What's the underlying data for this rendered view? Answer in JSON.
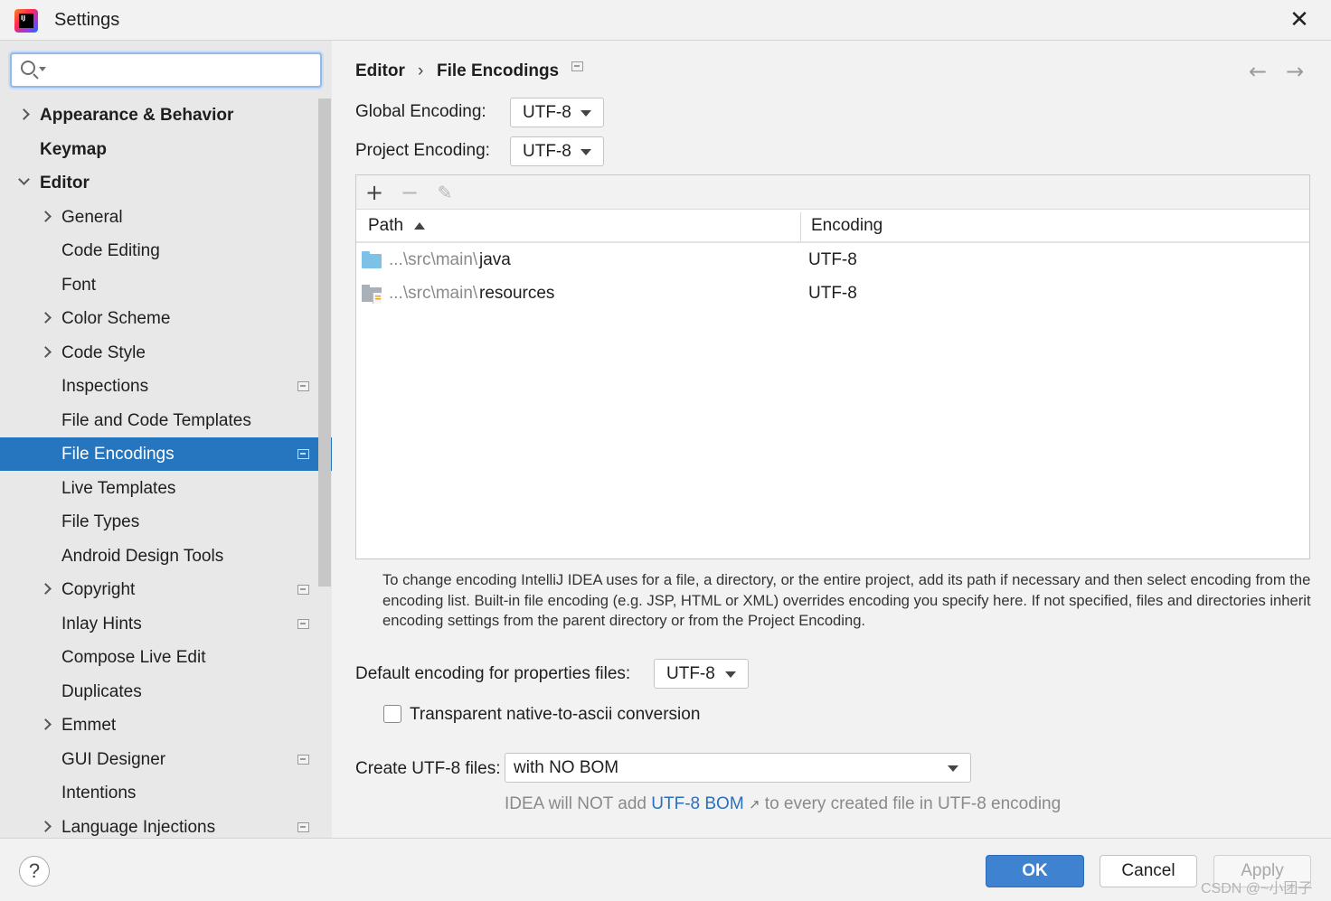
{
  "window": {
    "title": "Settings",
    "close_glyph": "✕",
    "logo_text": "IJ"
  },
  "search": {
    "placeholder": "",
    "value": ""
  },
  "sidebar": {
    "items": [
      {
        "label": "Appearance & Behavior",
        "expander": "collapsed",
        "bold": true
      },
      {
        "label": "Keymap",
        "bold": true
      },
      {
        "label": "Editor",
        "expander": "expanded",
        "bold": true
      },
      {
        "label": "General",
        "expander": "collapsed"
      },
      {
        "label": "Code Editing"
      },
      {
        "label": "Font"
      },
      {
        "label": "Color Scheme",
        "expander": "collapsed"
      },
      {
        "label": "Code Style",
        "expander": "collapsed"
      },
      {
        "label": "Inspections",
        "project_icon": true
      },
      {
        "label": "File and Code Templates"
      },
      {
        "label": "File Encodings",
        "project_icon": true,
        "selected": true
      },
      {
        "label": "Live Templates"
      },
      {
        "label": "File Types"
      },
      {
        "label": "Android Design Tools"
      },
      {
        "label": "Copyright",
        "expander": "collapsed",
        "project_icon": true
      },
      {
        "label": "Inlay Hints",
        "project_icon": true
      },
      {
        "label": "Compose Live Edit"
      },
      {
        "label": "Duplicates"
      },
      {
        "label": "Emmet",
        "expander": "collapsed"
      },
      {
        "label": "GUI Designer",
        "project_icon": true
      },
      {
        "label": "Intentions"
      },
      {
        "label": "Language Injections",
        "expander": "collapsed",
        "project_icon": true
      }
    ]
  },
  "breadcrumb": {
    "parent": "Editor",
    "separator": "›",
    "current": "File Encodings"
  },
  "nav": {
    "back_glyph": "←",
    "forward_glyph": "→"
  },
  "global_encoding": {
    "label": "Global Encoding:",
    "value": "UTF-8"
  },
  "project_encoding": {
    "label": "Project Encoding:",
    "value": "UTF-8"
  },
  "toolbar": {
    "add_glyph": "+",
    "remove_glyph": "−",
    "edit_glyph": "✎"
  },
  "table": {
    "columns": [
      "Path",
      "Encoding"
    ],
    "rows": [
      {
        "path_prefix": "...\\src\\main\\",
        "path_name": "java",
        "encoding": "UTF-8",
        "icon": "source-folder-icon"
      },
      {
        "path_prefix": "...\\src\\main\\",
        "path_name": "resources",
        "encoding": "UTF-8",
        "icon": "resources-folder-icon"
      }
    ]
  },
  "info": "To change encoding IntelliJ IDEA uses for a file, a directory, or the entire project, add its path if necessary and then select encoding from the encoding list. Built-in file encoding (e.g. JSP, HTML or XML) overrides encoding you specify here. If not specified, files and directories inherit encoding settings from the parent directory or from the Project Encoding.",
  "properties_encoding": {
    "label": "Default encoding for properties files:",
    "value": "UTF-8"
  },
  "native_to_ascii": {
    "label": "Transparent native-to-ascii conversion",
    "checked": false
  },
  "create_utf8": {
    "label": "Create UTF-8 files:",
    "value": "with NO BOM"
  },
  "hint": {
    "before": "IDEA will NOT add ",
    "link": "UTF-8 BOM",
    "link_arrow": "↗",
    "after": " to every created file in UTF-8 encoding"
  },
  "footer": {
    "help_glyph": "?",
    "ok": "OK",
    "cancel": "Cancel",
    "apply": "Apply"
  },
  "watermark": "CSDN @~小团子",
  "colors": {
    "accent": "#2675bf",
    "ok_button": "#3e82d0",
    "link": "#2a6fc0"
  }
}
